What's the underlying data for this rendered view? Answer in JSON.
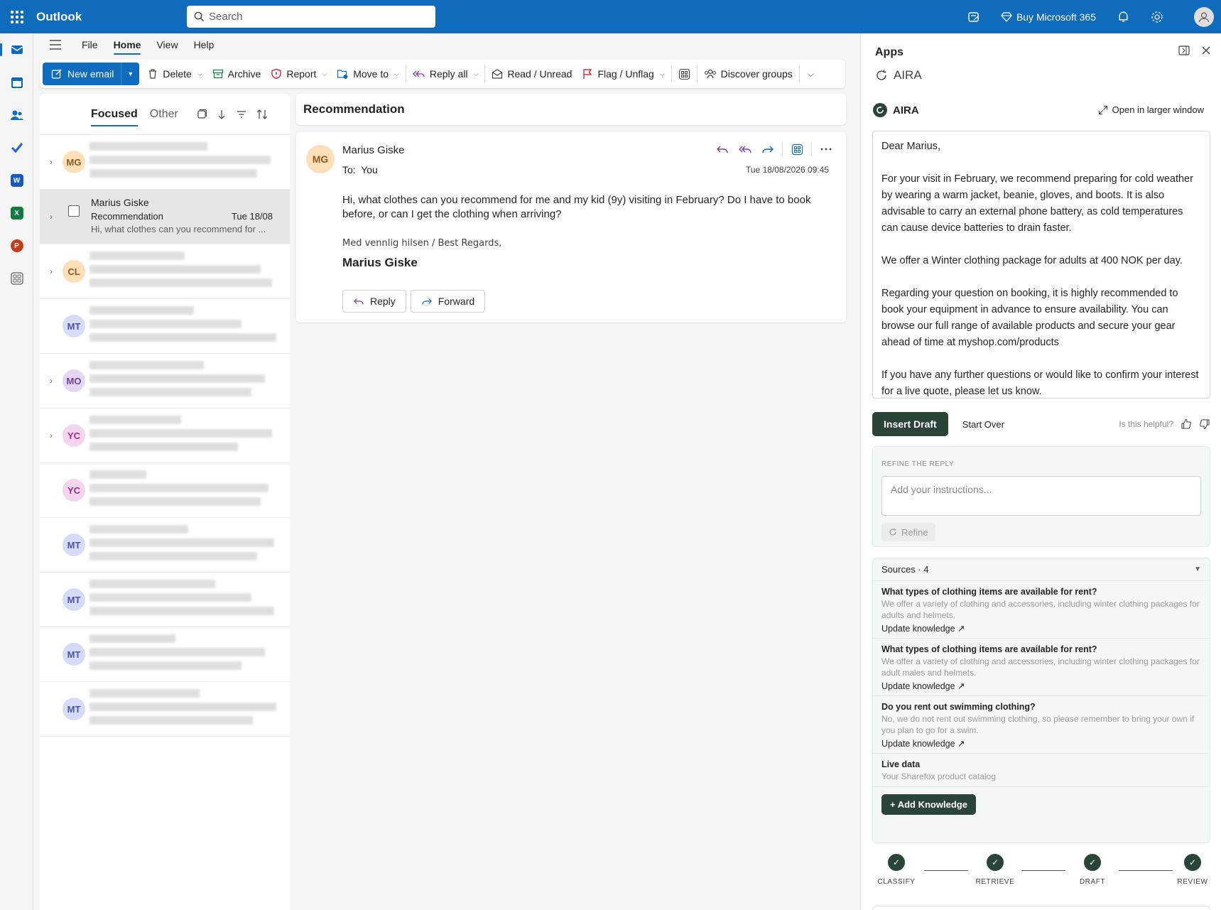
{
  "topbar": {
    "app_name": "Outlook",
    "search_placeholder": "Search",
    "buy_m365": "Buy Microsoft 365",
    "brand_color": "#0f6cbd"
  },
  "menu": {
    "tabs": [
      "File",
      "Home",
      "View",
      "Help"
    ],
    "active": "Home"
  },
  "ribbon": {
    "new_email": "New email",
    "delete": "Delete",
    "archive": "Archive",
    "report": "Report",
    "move_to": "Move to",
    "reply_all": "Reply all",
    "read_unread": "Read / Unread",
    "flag_unflag": "Flag / Unflag",
    "discover_groups": "Discover groups"
  },
  "message_list": {
    "tabs": [
      "Focused",
      "Other"
    ],
    "rows": [
      {
        "initials": "MG",
        "avatar_bg": "#fde0b8",
        "avatar_fg": "#8a5a1e",
        "blurred": true
      },
      {
        "sender": "Marius Giske",
        "subject": "Recommendation",
        "date": "Tue 18/08",
        "preview": "Hi, what clothes can you recommend for ...",
        "selected": true
      },
      {
        "initials": "CL",
        "avatar_bg": "#fde0b8",
        "avatar_fg": "#8a5a1e",
        "blurred": true
      },
      {
        "initials": "MT",
        "avatar_bg": "#d6dcf7",
        "avatar_fg": "#4a53a8",
        "blurred": true
      },
      {
        "initials": "MO",
        "avatar_bg": "#e4d7f5",
        "avatar_fg": "#6b3fa0",
        "blurred": true
      },
      {
        "initials": "YC",
        "avatar_bg": "#f3d5ef",
        "avatar_fg": "#9b2e8f",
        "blurred": true
      },
      {
        "initials": "YC",
        "avatar_bg": "#f3d5ef",
        "avatar_fg": "#9b2e8f",
        "blurred": true
      },
      {
        "initials": "MT",
        "avatar_bg": "#d6dcf7",
        "avatar_fg": "#4a53a8",
        "blurred": true
      },
      {
        "initials": "MT",
        "avatar_bg": "#d6dcf7",
        "avatar_fg": "#4a53a8",
        "blurred": true
      },
      {
        "initials": "MT",
        "avatar_bg": "#d6dcf7",
        "avatar_fg": "#4a53a8",
        "blurred": true
      },
      {
        "initials": "MT",
        "avatar_bg": "#d6dcf7",
        "avatar_fg": "#4a53a8",
        "blurred": true
      }
    ]
  },
  "reading": {
    "subject": "Recommendation",
    "from_initials": "MG",
    "from": "Marius Giske",
    "to_label": "To:",
    "to": "You",
    "date": "Tue 18/08/2026 09:45",
    "body": "Hi, what clothes can you recommend for me and my kid (9y) visiting in February? Do I have to book before, or can I get the clothing when arriving?",
    "sig_greeting": "Med vennlig hilsen / Best Regards,",
    "sig_name": "Marius Giske",
    "reply": "Reply",
    "forward": "Forward"
  },
  "apps": {
    "title": "Apps",
    "addin_name": "AIRA",
    "aira_title": "AIRA",
    "open_larger": "Open in larger window",
    "draft": [
      "Dear Marius,",
      "For your visit in February, we recommend preparing for cold weather by wearing a warm jacket, beanie, gloves, and boots. It is also advisable to carry an external phone battery, as cold temperatures can cause device batteries to drain faster.",
      "We offer a Winter clothing package for adults at 400 NOK per day.",
      "Regarding your question on booking, it is highly recommended to book your equipment in advance to ensure availability. You can browse our full range of available products and secure your gear ahead of time at myshop.com/products",
      "If you have any further questions or would like to confirm your interest for a live quote, please let us know."
    ],
    "insert_draft": "Insert Draft",
    "start_over": "Start Over",
    "helpful": "Is this helpful?",
    "refine_label": "REFINE THE REPLY",
    "refine_placeholder": "Add your instructions...",
    "refine_button": "Refine",
    "sources_title": "Sources · 4",
    "sources": [
      {
        "q": "What types of clothing items are available for rent?",
        "a": "We offer a variety of clothing and accessories, including winter clothing packages for adults and helmets.",
        "link": "Update knowledge ↗"
      },
      {
        "q": "What types of clothing items are available for rent?",
        "a": "We offer a variety of clothing and accessories, including winter clothing packages for adult males and helmets.",
        "link": "Update knowledge ↗"
      },
      {
        "q": "Do you rent out swimming clothing?",
        "a": "No, we do not rent out swimming clothing, so please remember to bring your own if you plan to go for a swim.",
        "link": "Update knowledge ↗"
      },
      {
        "q": "Live data",
        "a": "Your Sharefox product catalog",
        "link": ""
      }
    ],
    "add_knowledge": "+ Add Knowledge",
    "steps": [
      "CLASSIFY",
      "RETRIEVE",
      "DRAFT",
      "REVIEW"
    ],
    "accent_color": "#2b4438"
  }
}
